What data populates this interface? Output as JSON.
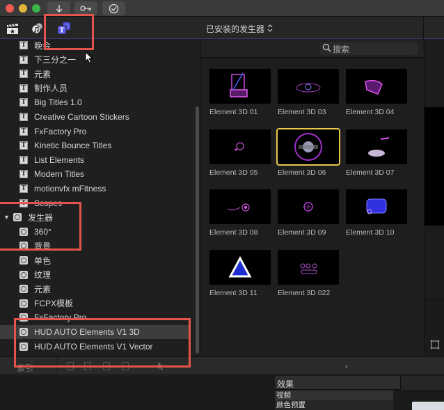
{
  "titlebar": {
    "buttons": [
      {
        "name": "import-button",
        "icon": "down-arrow-icon"
      },
      {
        "name": "keywords-button",
        "icon": "key-icon"
      },
      {
        "name": "background-tasks-button",
        "icon": "check-circle-icon"
      }
    ]
  },
  "toolbar": {
    "tabs": [
      {
        "name": "libraries-tab",
        "icon": "clapper-star-icon",
        "active": false
      },
      {
        "name": "photos-audio-tab",
        "icon": "music-photos-icon",
        "active": false
      },
      {
        "name": "titles-generators-tab",
        "icon": "titles-generators-icon",
        "active": true
      }
    ],
    "category_title": "已安装的发生器",
    "category_updown": "⌃⌄",
    "accent_color": "#5a5af0"
  },
  "sidebar": {
    "items": [
      {
        "label": "晚会",
        "type": "title",
        "indent": 1
      },
      {
        "label": "下三分之一",
        "type": "title",
        "indent": 1
      },
      {
        "label": "元素",
        "type": "title",
        "indent": 1
      },
      {
        "label": "制作人员",
        "type": "title",
        "indent": 1
      },
      {
        "label": "Big Titles 1.0",
        "type": "title",
        "indent": 1
      },
      {
        "label": "Creative Cartoon Stickers",
        "type": "title",
        "indent": 1
      },
      {
        "label": "FxFactory Pro",
        "type": "title",
        "indent": 1
      },
      {
        "label": "Kinetic Bounce Titles",
        "type": "title",
        "indent": 1
      },
      {
        "label": "List Elements",
        "type": "title",
        "indent": 1
      },
      {
        "label": "Modern Titles",
        "type": "title",
        "indent": 1
      },
      {
        "label": "motionvfx mFitness",
        "type": "title",
        "indent": 1
      },
      {
        "label": "Scopes",
        "type": "title",
        "indent": 1
      },
      {
        "label": "发生器",
        "type": "generator-group",
        "indent": 0,
        "expanded": true
      },
      {
        "label": "360°",
        "type": "generator",
        "indent": 1
      },
      {
        "label": "背景",
        "type": "generator",
        "indent": 1
      },
      {
        "label": "单色",
        "type": "generator",
        "indent": 1
      },
      {
        "label": "纹理",
        "type": "generator",
        "indent": 1
      },
      {
        "label": "元素",
        "type": "generator",
        "indent": 1
      },
      {
        "label": "FCPX模板",
        "type": "generator",
        "indent": 1
      },
      {
        "label": "FxFactory Pro",
        "type": "generator",
        "indent": 1
      },
      {
        "label": "HUD AUTO Elements V1 3D",
        "type": "generator",
        "indent": 1,
        "selected": true
      },
      {
        "label": "HUD AUTO Elements V1 Vector",
        "type": "generator",
        "indent": 1
      }
    ]
  },
  "browser": {
    "search_placeholder": "搜索",
    "tiles": [
      {
        "label": "Element 3D 01",
        "art": "seat"
      },
      {
        "label": "Element 3D 03",
        "art": "dash"
      },
      {
        "label": "Element 3D 04",
        "art": "panel"
      },
      {
        "label": "Element 3D 05",
        "art": "gear"
      },
      {
        "label": "Element 3D 06",
        "art": "wheel",
        "selected": true
      },
      {
        "label": "Element 3D 07",
        "art": "pad"
      },
      {
        "label": "Element 3D 08",
        "art": "lever"
      },
      {
        "label": "Element 3D 09",
        "art": "crosshair"
      },
      {
        "label": "Element 3D 10",
        "art": "car"
      },
      {
        "label": "Element 3D 11",
        "art": "triangle"
      },
      {
        "label": "Element 3D 022",
        "art": "controls"
      }
    ],
    "selection_color": "#e7c94c"
  },
  "bottom_bar": {
    "index_label": "索引",
    "collapse_icon": "‹"
  },
  "effects": {
    "header": "效果",
    "items": [
      "视频",
      "颜色预置"
    ]
  },
  "annotation_color": "#e5544b"
}
